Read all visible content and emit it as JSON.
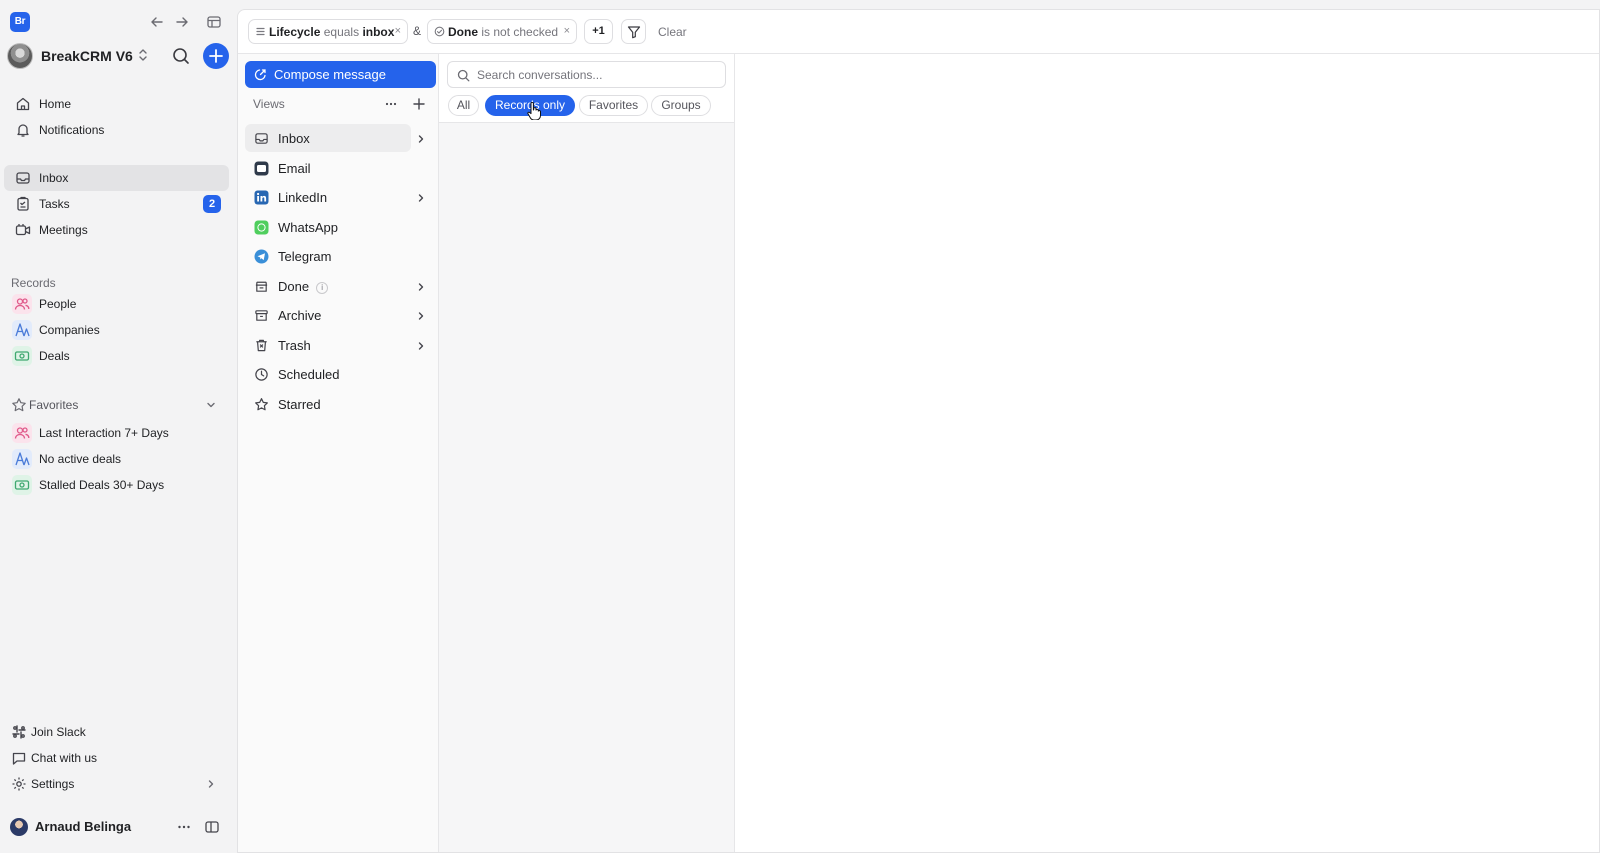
{
  "colors": {
    "accent": "#2563eb",
    "sidebar_bg": "#f3f3f4",
    "panel_bg": "#ffffff"
  },
  "app": {
    "logo_text": "Br"
  },
  "workspace": {
    "name": "BreakCRM V6"
  },
  "nav": {
    "home": "Home",
    "notifications": "Notifications",
    "inbox": "Inbox",
    "tasks": "Tasks",
    "tasks_badge": "2",
    "meetings": "Meetings"
  },
  "records": {
    "label": "Records",
    "items": [
      {
        "label": "People",
        "icon": "people-icon",
        "color": "#e05a8a"
      },
      {
        "label": "Companies",
        "icon": "companies-icon",
        "color": "#4a7bd8"
      },
      {
        "label": "Deals",
        "icon": "deals-icon",
        "color": "#3fa870"
      }
    ]
  },
  "favorites": {
    "label": "Favorites",
    "items": [
      {
        "label": "Last Interaction 7+ Days",
        "icon": "people-icon"
      },
      {
        "label": "No active deals",
        "icon": "companies-icon"
      },
      {
        "label": "Stalled Deals 30+ Days",
        "icon": "deals-icon"
      }
    ]
  },
  "footer": {
    "join_slack": "Join Slack",
    "chat_with_us": "Chat with us",
    "settings": "Settings",
    "user_name": "Arnaud Belinga"
  },
  "filters": {
    "chip1": {
      "field": "Lifecycle",
      "op": "equals",
      "value": "inbox"
    },
    "conj": "&",
    "chip2": {
      "field": "Done",
      "op": "is not checked"
    },
    "more": "+1",
    "clear": "Clear"
  },
  "views": {
    "compose": "Compose message",
    "label": "Views",
    "items": [
      {
        "label": "Inbox",
        "icon": "inbox-icon",
        "chevron": true,
        "active": true
      },
      {
        "label": "Email",
        "icon": "email-icon",
        "chevron": false
      },
      {
        "label": "LinkedIn",
        "icon": "linkedin-icon",
        "chevron": true
      },
      {
        "label": "WhatsApp",
        "icon": "whatsapp-icon",
        "chevron": false
      },
      {
        "label": "Telegram",
        "icon": "telegram-icon",
        "chevron": false
      },
      {
        "label": "Done",
        "icon": "done-icon",
        "chevron": true,
        "info": "i"
      },
      {
        "label": "Archive",
        "icon": "archive-icon",
        "chevron": true
      },
      {
        "label": "Trash",
        "icon": "trash-icon",
        "chevron": true
      },
      {
        "label": "Scheduled",
        "icon": "clock-icon",
        "chevron": false
      },
      {
        "label": "Starred",
        "icon": "star-icon",
        "chevron": false
      }
    ]
  },
  "conversations": {
    "search_placeholder": "Search conversations...",
    "search_value": "",
    "tabs": [
      {
        "label": "All",
        "selected": false
      },
      {
        "label": "Records only",
        "selected": true
      },
      {
        "label": "Favorites",
        "selected": false
      },
      {
        "label": "Groups",
        "selected": false
      }
    ]
  }
}
